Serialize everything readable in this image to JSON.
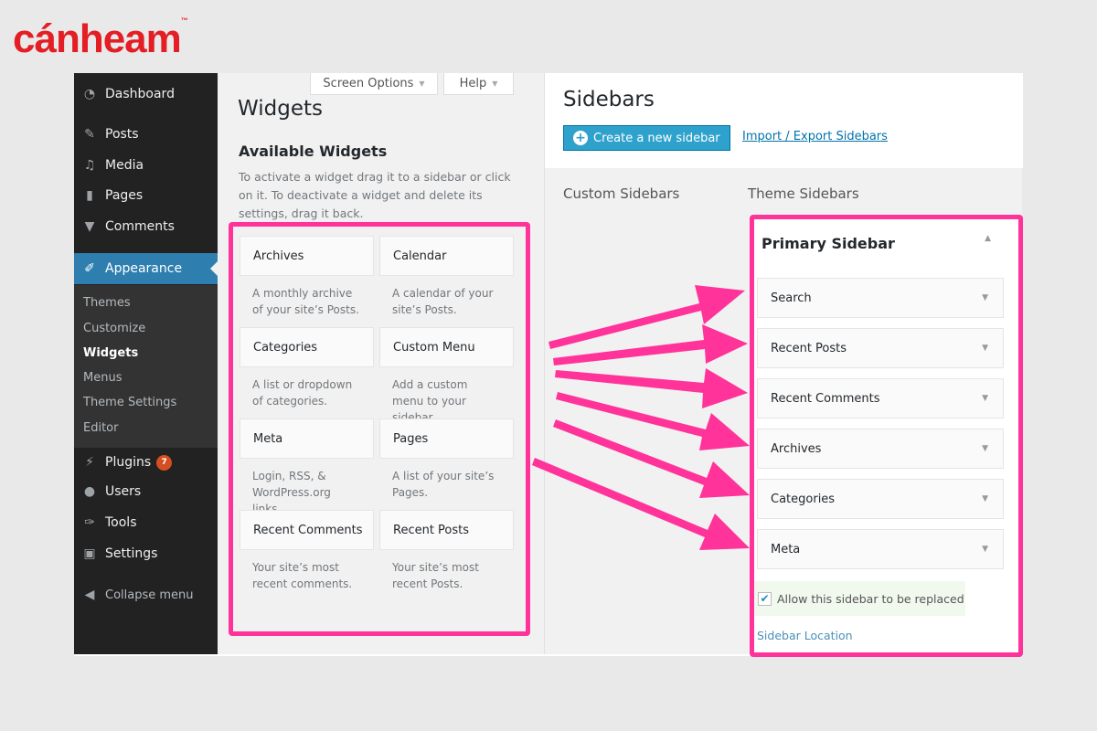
{
  "logo": {
    "text": "cánheam",
    "tm": "™",
    "color": "#e31e24"
  },
  "menu": {
    "items": [
      {
        "label": "Dashboard",
        "icon": "dashboard-icon"
      },
      {
        "label": "Posts",
        "icon": "pin-icon"
      },
      {
        "label": "Media",
        "icon": "media-icon"
      },
      {
        "label": "Pages",
        "icon": "pages-icon"
      },
      {
        "label": "Comments",
        "icon": "comment-icon"
      },
      {
        "label": "Appearance",
        "icon": "brush-icon",
        "active": true
      },
      {
        "label": "Plugins",
        "icon": "plugin-icon",
        "badge": "7"
      },
      {
        "label": "Users",
        "icon": "user-icon"
      },
      {
        "label": "Tools",
        "icon": "wrench-icon"
      },
      {
        "label": "Settings",
        "icon": "settings-icon"
      },
      {
        "label": "Collapse menu",
        "icon": "collapse-icon"
      }
    ],
    "submenu": [
      "Themes",
      "Customize",
      "Widgets",
      "Menus",
      "Theme Settings",
      "Editor"
    ],
    "current_sub": "Widgets",
    "accent": "#2e7eb0"
  },
  "toolbar": {
    "screen_options": "Screen Options",
    "help": "Help"
  },
  "page": {
    "title": "Widgets",
    "available_title": "Available Widgets",
    "available_desc": "To activate a widget drag it to a sidebar or click on it. To deactivate a widget and delete its settings, drag it back."
  },
  "widgets": [
    {
      "title": "Archives",
      "desc": "A monthly archive of your site’s Posts."
    },
    {
      "title": "Calendar",
      "desc": "A calendar of your site’s Posts."
    },
    {
      "title": "Categories",
      "desc": "A list or dropdown of categories."
    },
    {
      "title": "Custom Menu",
      "desc": "Add a custom menu to your sidebar."
    },
    {
      "title": "Meta",
      "desc": "Login, RSS, & WordPress.org links."
    },
    {
      "title": "Pages",
      "desc": "A list of your site’s Pages."
    },
    {
      "title": "Recent Comments",
      "desc": "Your site’s most recent comments."
    },
    {
      "title": "Recent Posts",
      "desc": "Your site’s most recent Posts."
    }
  ],
  "sidebars": {
    "title": "Sidebars",
    "create_button": "Create a new sidebar",
    "import_link": "Import / Export Sidebars",
    "custom_label": "Custom Sidebars",
    "theme_label": "Theme Sidebars",
    "primary": {
      "title": "Primary Sidebar",
      "widgets": [
        "Search",
        "Recent Posts",
        "Recent Comments",
        "Archives",
        "Categories",
        "Meta"
      ],
      "allow_replace": "Allow this sidebar to be replaced",
      "allow_checked": true,
      "location_link": "Sidebar Location"
    }
  },
  "highlight_color": "#ff3399"
}
